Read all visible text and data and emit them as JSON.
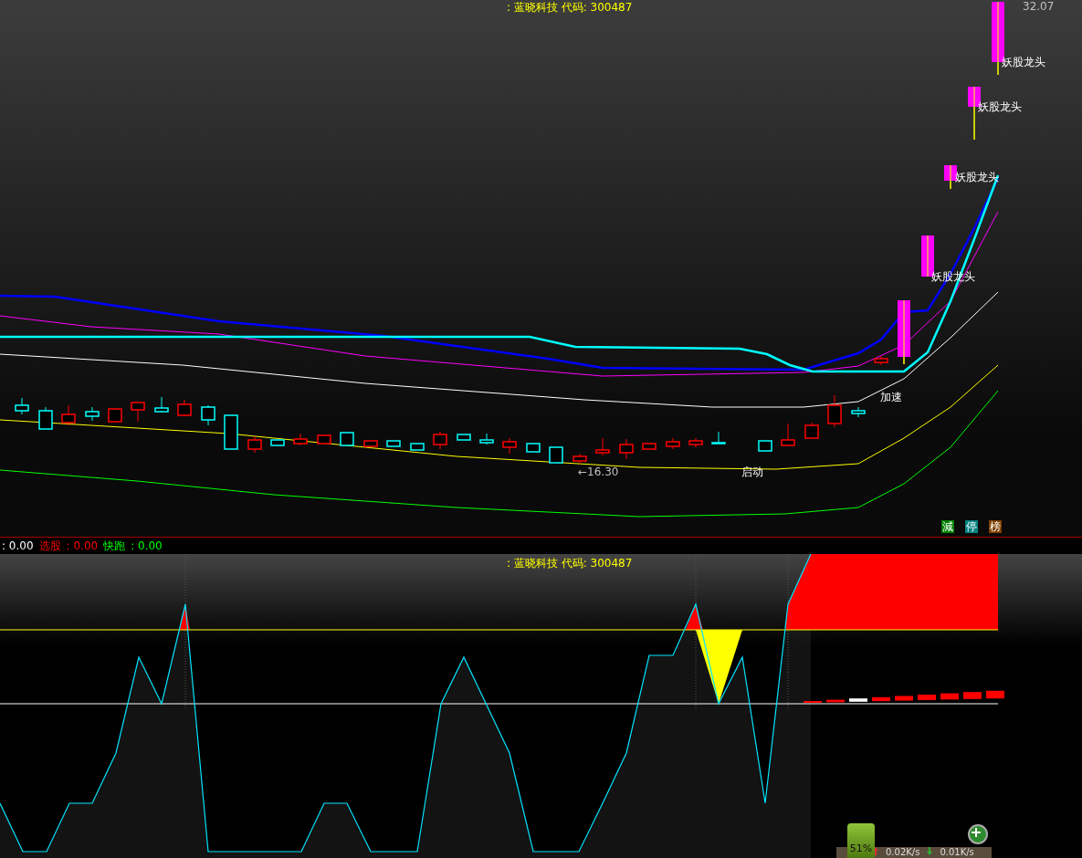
{
  "main_chart": {
    "title": ": 蓝晓科技 代码: 300487",
    "high_label": "32.07",
    "low_label": "←16.30",
    "signals": [
      {
        "text": "妖股龙头"
      },
      {
        "text": "妖股龙头"
      },
      {
        "text": "妖股龙头"
      },
      {
        "text": "妖股龙头"
      },
      {
        "text": "加速"
      },
      {
        "text": "启动"
      }
    ],
    "badges": [
      {
        "text": "減",
        "color": "#008000"
      },
      {
        "text": "停",
        "color": "#008080"
      },
      {
        "text": "榜",
        "color": "#804000"
      }
    ]
  },
  "status": [
    {
      "value": ": 0.00",
      "color": "#ffffff"
    },
    {
      "label": "选股",
      "value": ": 0.00",
      "color": "#ff0000"
    },
    {
      "label": "快跑",
      "value": ": 0.00",
      "color": "#00ff00"
    }
  ],
  "sub_chart": {
    "title": ": 蓝晓科技 代码: 300487"
  },
  "widget": {
    "percent": "51%",
    "upload": "0.02K/s",
    "download": "0.01K/s"
  }
}
